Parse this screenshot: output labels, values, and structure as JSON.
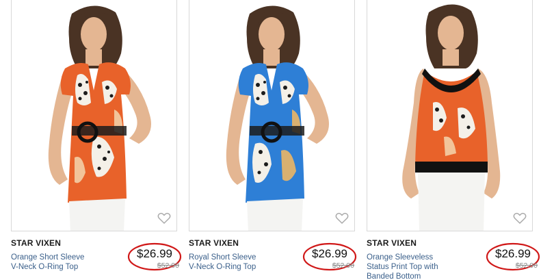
{
  "products": [
    {
      "brand": "STAR VIXEN",
      "name_line1": "Orange Short Sleeve",
      "name_line2": "V-Neck O-Ring Top",
      "name_line3": "",
      "price": "$26.99",
      "original_price": "$52.00",
      "image": "orange short sleeve top model photo",
      "favorite_icon": "heart-outline-icon",
      "colors": {
        "top": "#e8622a",
        "pattern": "#1c1c1c",
        "skin": "#e4b692",
        "hair": "#4a3324",
        "pants": "#f4f4f2"
      }
    },
    {
      "brand": "STAR VIXEN",
      "name_line1": "Royal Short Sleeve",
      "name_line2": "V-Neck O-Ring Top",
      "name_line3": "",
      "price": "$26.99",
      "original_price": "$52.00",
      "image": "royal blue short sleeve top model photo",
      "favorite_icon": "heart-outline-icon",
      "colors": {
        "top": "#2e7fd6",
        "pattern": "#1c1c1c",
        "skin": "#e4b692",
        "hair": "#4a3324",
        "pants": "#f4f4f2"
      }
    },
    {
      "brand": "STAR VIXEN",
      "name_line1": "Orange Sleeveless",
      "name_line2": "Status Print Top with",
      "name_line3": "Banded Bottom",
      "price": "$26.99",
      "original_price": "$52.00",
      "image": "orange sleeveless top model photo",
      "favorite_icon": "heart-outline-icon",
      "colors": {
        "top": "#e8622a",
        "pattern": "#1c1c1c",
        "skin": "#e4b692",
        "hair": "#4a3324",
        "pants": "#f4f4f2"
      }
    }
  ],
  "annotation_color": "#d01818"
}
